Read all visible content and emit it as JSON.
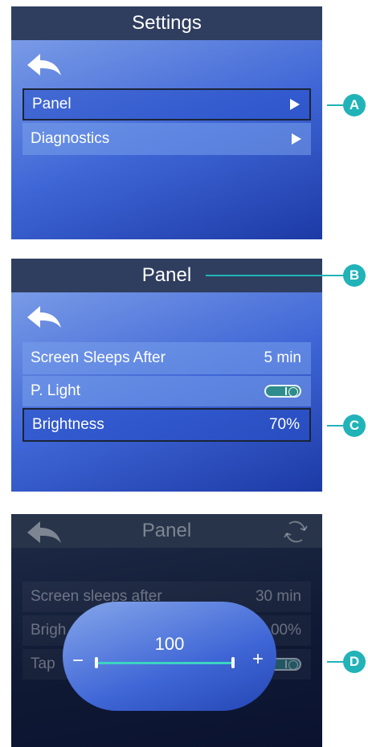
{
  "screen1": {
    "title": "Settings",
    "items": [
      {
        "label": "Panel"
      },
      {
        "label": "Diagnostics"
      }
    ]
  },
  "screen2": {
    "title": "Panel",
    "rows": [
      {
        "label": "Screen Sleeps After",
        "value": "5 min"
      },
      {
        "label": "P. Light",
        "toggle": "on"
      },
      {
        "label": "Brightness",
        "value": "70%"
      }
    ]
  },
  "screen3": {
    "title": "Panel",
    "rows": [
      {
        "label": "Screen sleeps after",
        "value": "30 min"
      },
      {
        "label": "Brigh",
        "value": "00%"
      },
      {
        "label": "Tap",
        "toggle": "on"
      }
    ],
    "popup": {
      "value": "100",
      "minus": "−",
      "plus": "+"
    }
  },
  "callouts": {
    "a": "A",
    "b": "B",
    "c": "C",
    "d": "D"
  },
  "colors": {
    "accent": "#21b3b8",
    "titlebar": "#2f3e5f",
    "slider": "#3cd3c2"
  },
  "icons": {
    "back": "back-arrow-icon",
    "next": "play-triangle-icon",
    "refresh": "refresh-icon"
  }
}
